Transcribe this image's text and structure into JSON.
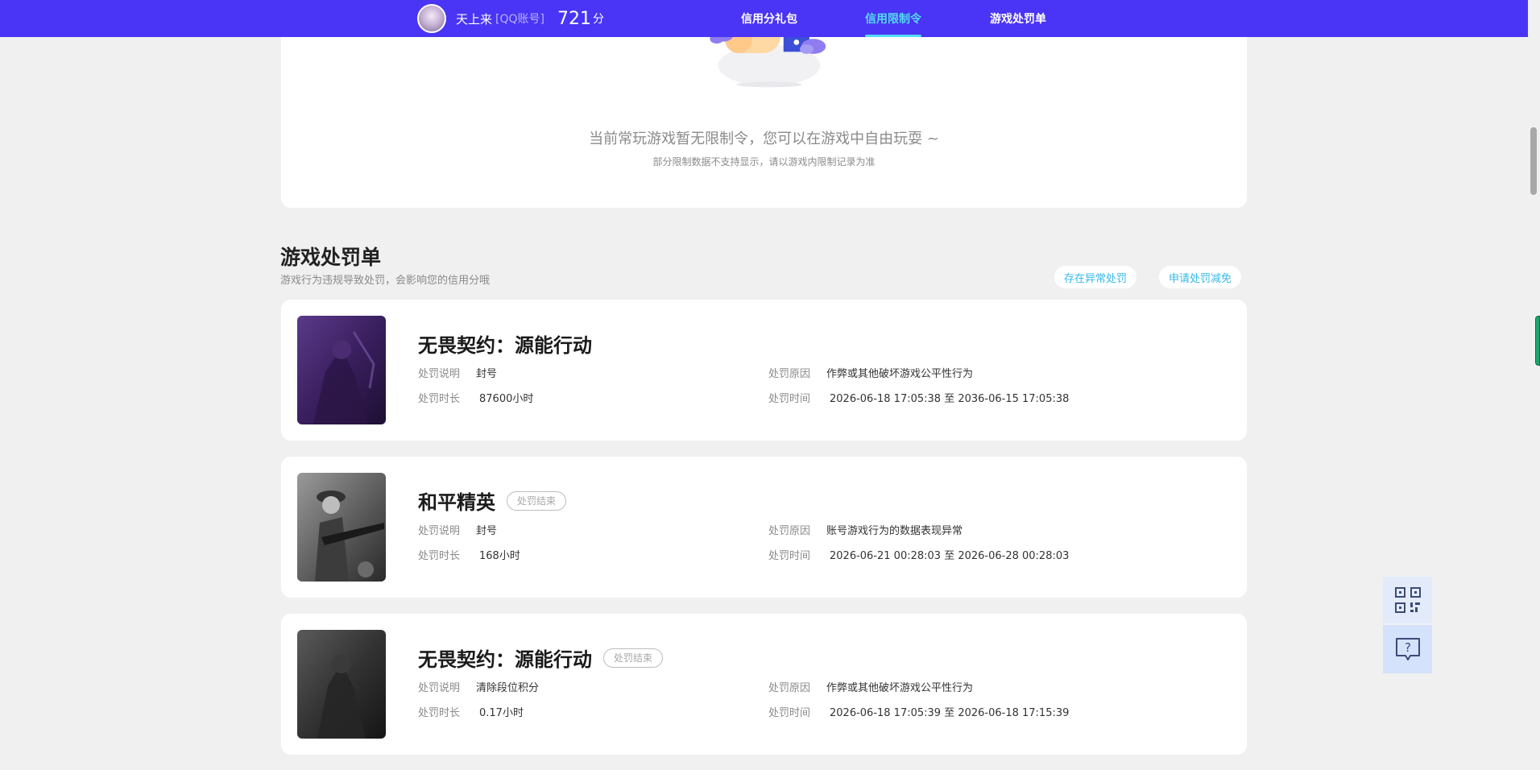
{
  "header": {
    "user_name": "天上来",
    "account_type": "[QQ账号]",
    "score": "721",
    "score_unit": "分",
    "nav": [
      {
        "label": "信用分礼包",
        "active": false
      },
      {
        "label": "信用限制令",
        "active": true
      },
      {
        "label": "游戏处罚单",
        "active": false
      }
    ]
  },
  "restriction": {
    "empty_message": "当前常玩游戏暂无限制令，您可以在游戏中自由玩耍 ~",
    "empty_note": "部分限制数据不支持显示，请以游戏内限制记录为准"
  },
  "penalty_section": {
    "title": "游戏处罚单",
    "subtitle": "游戏行为违规导致处罚，会影响您的信用分哦",
    "button_abnormal": "存在异常处罚",
    "button_reduce": "申请处罚减免"
  },
  "labels": {
    "desc": "处罚说明",
    "duration": "处罚时长",
    "reason": "处罚原因",
    "time": "处罚时间"
  },
  "penalties": [
    {
      "game": "无畏契约：源能行动",
      "status": "",
      "desc": "封号",
      "duration": "87600小时",
      "reason": "作弊或其他破坏游戏公平性行为",
      "time": "2026-06-18 17:05:38 至 2036-06-15 17:05:38"
    },
    {
      "game": "和平精英",
      "status": "处罚结束",
      "desc": "封号",
      "duration": "168小时",
      "reason": "账号游戏行为的数据表现异常",
      "time": "2026-06-21 00:28:03 至 2026-06-28 00:28:03"
    },
    {
      "game": "无畏契约：源能行动",
      "status": "处罚结束",
      "desc": "清除段位积分",
      "duration": "0.17小时",
      "reason": "作弊或其他破坏游戏公平性行为",
      "time": "2026-06-18 17:05:39 至 2026-06-18 17:15:39"
    }
  ],
  "colors": {
    "topbar": "#4a34f5",
    "accent": "#52dcf2",
    "pill_text": "#35b8e8"
  },
  "icons": [
    "qr-code-icon",
    "help-chat-icon"
  ]
}
